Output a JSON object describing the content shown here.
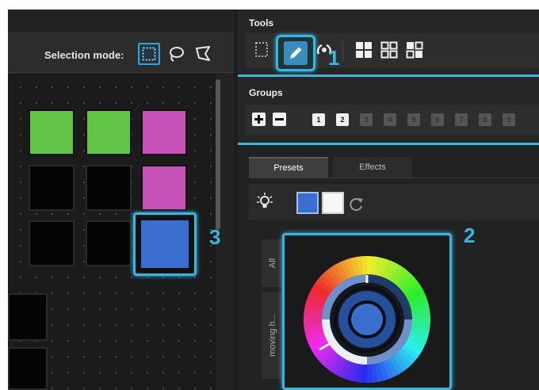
{
  "selection": {
    "label": "Selection mode:",
    "modes": [
      "rectangle-select-icon",
      "lasso-select-icon",
      "polygon-select-icon"
    ],
    "active_mode": "rectangle-select-icon"
  },
  "grid": {
    "cells": [
      {
        "color": "#62c446"
      },
      {
        "color": "#62c446"
      },
      {
        "color": "#c651b7"
      },
      {
        "color": "#050505"
      },
      {
        "color": "#050505"
      },
      {
        "color": "#c651b7"
      },
      {
        "color": "#050505"
      },
      {
        "color": "#050505"
      },
      {
        "color": "#3b6fcf",
        "selected": true
      }
    ]
  },
  "tools": {
    "title": "Tools",
    "items": [
      "select-tool-icon",
      "pencil-icon",
      "wand-icon",
      "grid-layout-icon",
      "grid-outline-icon",
      "grid-mixed-icon"
    ],
    "active": "pencil-icon"
  },
  "groups": {
    "title": "Groups",
    "numbers": [
      "1",
      "2",
      "3",
      "4",
      "5",
      "6",
      "7",
      "8",
      "9"
    ],
    "active_count": 2
  },
  "presets": {
    "tabs": [
      {
        "label": "Presets",
        "active": true
      },
      {
        "label": "Effects",
        "active": false
      }
    ],
    "swatches": [
      "#3b6fcf",
      "#f6f6f6"
    ],
    "side_tabs": [
      "All",
      "moving h..."
    ]
  },
  "callouts": [
    "1",
    "2",
    "3"
  ],
  "accent_color": "#35b6e3"
}
